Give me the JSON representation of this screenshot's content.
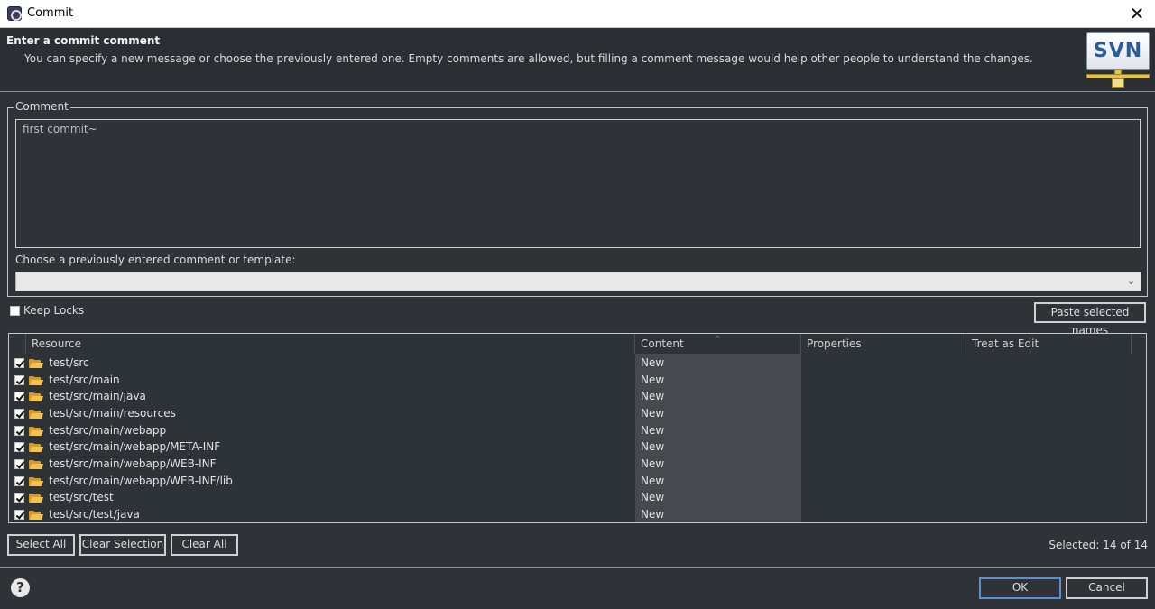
{
  "window": {
    "title": "Commit",
    "close_glyph": "✕"
  },
  "header": {
    "title": "Enter a commit comment",
    "description": "You can specify a new message or choose the previously entered one. Empty comments are allowed, but filling a comment message would help other people to understand the changes.",
    "logo_text": "SVN"
  },
  "comment": {
    "group_label": "Comment",
    "value": "first commit~",
    "choose_label": "Choose a previously entered comment or template:",
    "chevron": "⌄"
  },
  "options": {
    "keep_locks_label": "Keep Locks",
    "keep_locks_checked": false,
    "paste_button": "Paste selected names"
  },
  "table": {
    "columns": [
      "Resource",
      "Content",
      "Properties",
      "Treat as Edit"
    ],
    "sort_indicator": "^",
    "rows": [
      {
        "resource": "test/src",
        "content": "New",
        "checked": true
      },
      {
        "resource": "test/src/main",
        "content": "New",
        "checked": true
      },
      {
        "resource": "test/src/main/java",
        "content": "New",
        "checked": true
      },
      {
        "resource": "test/src/main/resources",
        "content": "New",
        "checked": true
      },
      {
        "resource": "test/src/main/webapp",
        "content": "New",
        "checked": true
      },
      {
        "resource": "test/src/main/webapp/META-INF",
        "content": "New",
        "checked": true
      },
      {
        "resource": "test/src/main/webapp/WEB-INF",
        "content": "New",
        "checked": true
      },
      {
        "resource": "test/src/main/webapp/WEB-INF/lib",
        "content": "New",
        "checked": true
      },
      {
        "resource": "test/src/test",
        "content": "New",
        "checked": true
      },
      {
        "resource": "test/src/test/java",
        "content": "New",
        "checked": true
      }
    ]
  },
  "selection": {
    "select_all": "Select All",
    "clear_selection": "Clear Selection",
    "clear_all": "Clear All",
    "status": "Selected: 14 of 14"
  },
  "footer": {
    "help_glyph": "?",
    "ok": "OK",
    "cancel": "Cancel"
  },
  "icons": {
    "folder": "folder-open-icon",
    "help": "help-icon",
    "close": "close-icon"
  }
}
